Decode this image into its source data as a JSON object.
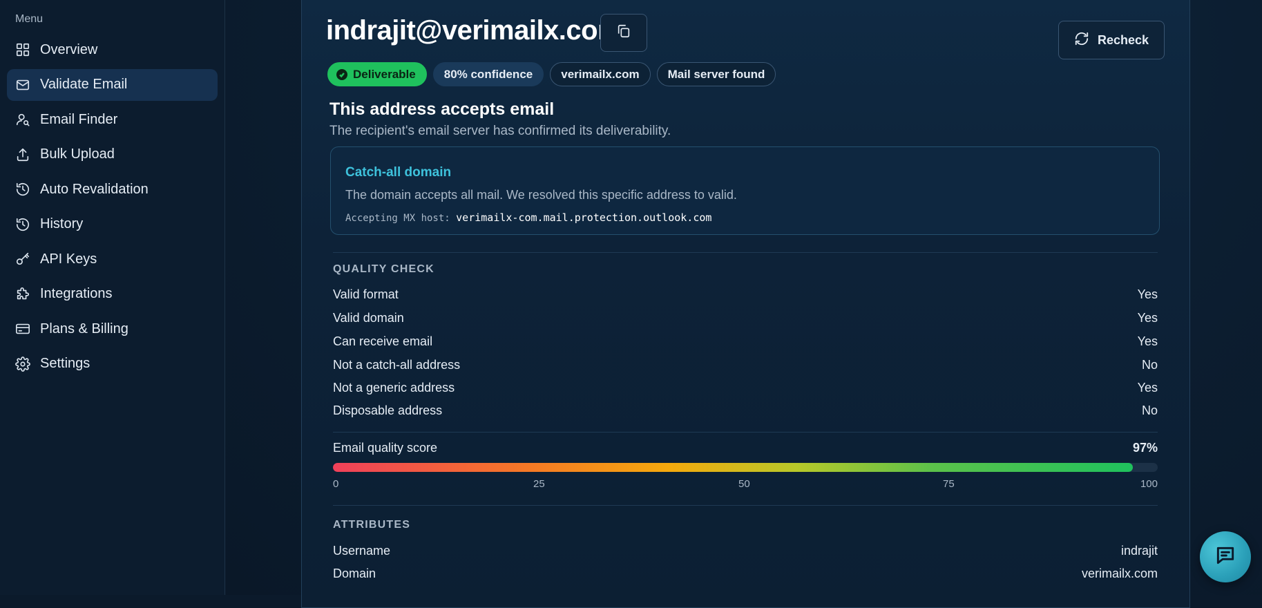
{
  "sidebar": {
    "heading": "Menu",
    "items": [
      {
        "label": "Overview",
        "icon": "grid-icon"
      },
      {
        "label": "Validate Email",
        "icon": "mail-icon"
      },
      {
        "label": "Email Finder",
        "icon": "user-search-icon"
      },
      {
        "label": "Bulk Upload",
        "icon": "upload-icon"
      },
      {
        "label": "Auto Revalidation",
        "icon": "history-icon"
      },
      {
        "label": "History",
        "icon": "clock-history-icon"
      },
      {
        "label": "API Keys",
        "icon": "key-icon"
      },
      {
        "label": "Integrations",
        "icon": "puzzle-icon"
      },
      {
        "label": "Plans & Billing",
        "icon": "credit-card-icon"
      },
      {
        "label": "Settings",
        "icon": "gear-icon"
      }
    ],
    "active_index": 1
  },
  "result": {
    "email": "indrajit@verimailx.com",
    "recheck_label": "Recheck",
    "badges": {
      "status": "Deliverable",
      "confidence": "80% confidence",
      "domain": "verimailx.com",
      "mail_server": "Mail server found"
    },
    "headline": "This address accepts email",
    "subheadline": "The recipient's email server has confirmed its deliverability.",
    "catch_all": {
      "title": "Catch-all domain",
      "text": "The domain accepts all mail. We resolved this specific address to valid.",
      "mx_label": "Accepting MX host:",
      "mx_host": "verimailx-com.mail.protection.outlook.com"
    }
  },
  "quality_check": {
    "heading": "QUALITY CHECK",
    "rows": [
      {
        "label": "Valid format",
        "value": "Yes"
      },
      {
        "label": "Valid domain",
        "value": "Yes"
      },
      {
        "label": "Can receive email",
        "value": "Yes"
      },
      {
        "label": "Not a catch-all address",
        "value": "No"
      },
      {
        "label": "Not a generic address",
        "value": "Yes"
      },
      {
        "label": "Disposable address",
        "value": "No"
      }
    ]
  },
  "score": {
    "label": "Email quality score",
    "value_text": "97%",
    "value": 97,
    "ticks": [
      "0",
      "25",
      "50",
      "75",
      "100"
    ]
  },
  "attributes": {
    "heading": "ATTRIBUTES",
    "rows": [
      {
        "label": "Username",
        "value": "indrajit"
      },
      {
        "label": "Domain",
        "value": "verimailx.com"
      }
    ]
  },
  "colors": {
    "accent": "#3ec2dc",
    "deliverable": "#1fc15d",
    "background": "#0b1a2b"
  }
}
